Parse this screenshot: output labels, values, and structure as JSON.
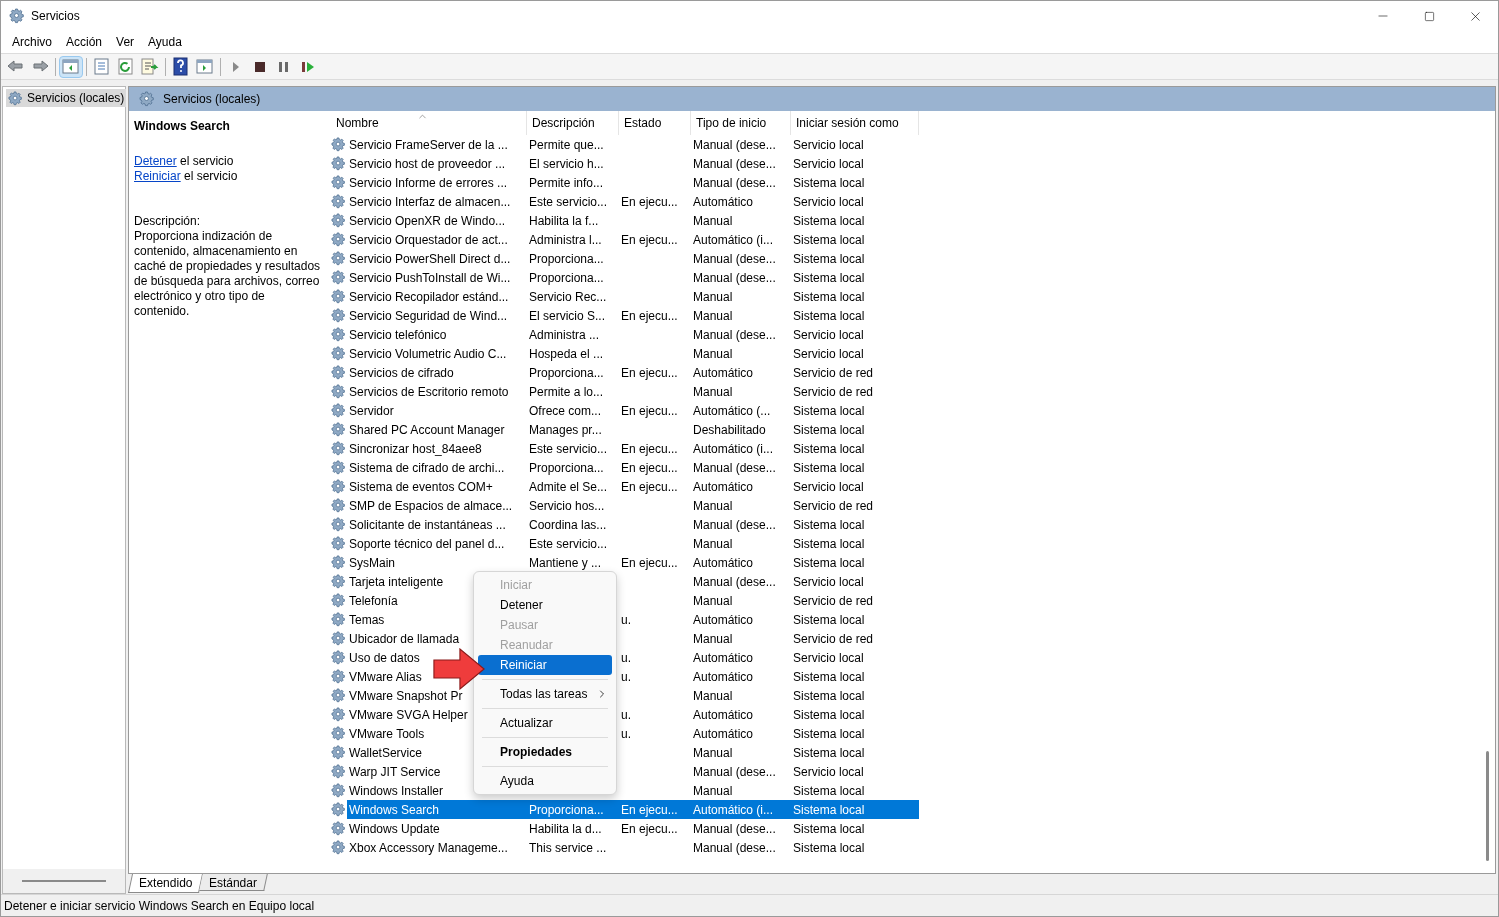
{
  "window": {
    "title": "Servicios"
  },
  "menu": [
    "Archivo",
    "Acción",
    "Ver",
    "Ayuda"
  ],
  "toolbar": [
    {
      "kind": "back",
      "selected": false
    },
    {
      "kind": "forward",
      "selected": false
    },
    {
      "kind": "tree",
      "selected": true
    },
    {
      "kind": "properties",
      "selected": false
    },
    {
      "kind": "refresh",
      "selected": false
    },
    {
      "kind": "export",
      "selected": false
    },
    {
      "kind": "help",
      "selected": false
    },
    {
      "kind": "view",
      "selected": false
    },
    {
      "kind": "play",
      "selected": false
    },
    {
      "kind": "stop",
      "selected": false
    },
    {
      "kind": "pause",
      "selected": false
    },
    {
      "kind": "restart",
      "selected": false
    }
  ],
  "tree": [
    {
      "label": "Servicios (locales)",
      "selected": true
    }
  ],
  "pane_title": "Servicios (locales)",
  "details": {
    "title": "Windows Search",
    "actions": [
      {
        "link": "Detener",
        "rest": " el servicio"
      },
      {
        "link": "Reiniciar",
        "rest": " el servicio"
      }
    ],
    "description_label": "Descripción:",
    "description": "Proporciona indización de contenido, almacenamiento en caché de propiedades y resultados de búsqueda para archivos, correo electrónico y otro tipo de contenido."
  },
  "table": {
    "columns": [
      "Nombre",
      "Descripción",
      "Estado",
      "Tipo de inicio",
      "Iniciar sesión como"
    ],
    "rows": [
      {
        "name": "Servicio FrameServer de la ...",
        "description": "Permite que...",
        "status": "",
        "startup": "Manual (dese...",
        "logon": "Servicio local",
        "selected": false
      },
      {
        "name": "Servicio host de proveedor ...",
        "description": "El servicio h...",
        "status": "",
        "startup": "Manual (dese...",
        "logon": "Servicio local",
        "selected": false
      },
      {
        "name": "Servicio Informe de errores ...",
        "description": "Permite info...",
        "status": "",
        "startup": "Manual (dese...",
        "logon": "Sistema local",
        "selected": false
      },
      {
        "name": "Servicio Interfaz de almacen...",
        "description": "Este servicio...",
        "status": "En ejecu...",
        "startup": "Automático",
        "logon": "Servicio local",
        "selected": false
      },
      {
        "name": "Servicio OpenXR de Windo...",
        "description": "Habilita la f...",
        "status": "",
        "startup": "Manual",
        "logon": "Sistema local",
        "selected": false
      },
      {
        "name": "Servicio Orquestador de act...",
        "description": "Administra l...",
        "status": "En ejecu...",
        "startup": "Automático (i...",
        "logon": "Sistema local",
        "selected": false
      },
      {
        "name": "Servicio PowerShell Direct d...",
        "description": "Proporciona...",
        "status": "",
        "startup": "Manual (dese...",
        "logon": "Sistema local",
        "selected": false
      },
      {
        "name": "Servicio PushToInstall de Wi...",
        "description": "Proporciona...",
        "status": "",
        "startup": "Manual (dese...",
        "logon": "Sistema local",
        "selected": false
      },
      {
        "name": "Servicio Recopilador estánd...",
        "description": "Servicio Rec...",
        "status": "",
        "startup": "Manual",
        "logon": "Sistema local",
        "selected": false
      },
      {
        "name": "Servicio Seguridad de Wind...",
        "description": "El servicio S...",
        "status": "En ejecu...",
        "startup": "Manual",
        "logon": "Sistema local",
        "selected": false
      },
      {
        "name": "Servicio telefónico",
        "description": "Administra ...",
        "status": "",
        "startup": "Manual (dese...",
        "logon": "Servicio local",
        "selected": false
      },
      {
        "name": "Servicio Volumetric Audio C...",
        "description": "Hospeda el ...",
        "status": "",
        "startup": "Manual",
        "logon": "Servicio local",
        "selected": false
      },
      {
        "name": "Servicios de cifrado",
        "description": "Proporciona...",
        "status": "En ejecu...",
        "startup": "Automático",
        "logon": "Servicio de red",
        "selected": false
      },
      {
        "name": "Servicios de Escritorio remoto",
        "description": "Permite a lo...",
        "status": "",
        "startup": "Manual",
        "logon": "Servicio de red",
        "selected": false
      },
      {
        "name": "Servidor",
        "description": "Ofrece com...",
        "status": "En ejecu...",
        "startup": "Automático (...",
        "logon": "Sistema local",
        "selected": false
      },
      {
        "name": "Shared PC Account Manager",
        "description": "Manages pr...",
        "status": "",
        "startup": "Deshabilitado",
        "logon": "Sistema local",
        "selected": false
      },
      {
        "name": "Sincronizar host_84aee8",
        "description": "Este servicio...",
        "status": "En ejecu...",
        "startup": "Automático (i...",
        "logon": "Sistema local",
        "selected": false
      },
      {
        "name": "Sistema de cifrado de archi...",
        "description": "Proporciona...",
        "status": "En ejecu...",
        "startup": "Manual (dese...",
        "logon": "Sistema local",
        "selected": false
      },
      {
        "name": "Sistema de eventos COM+",
        "description": "Admite el Se...",
        "status": "En ejecu...",
        "startup": "Automático",
        "logon": "Servicio local",
        "selected": false
      },
      {
        "name": "SMP de Espacios de almace...",
        "description": "Servicio hos...",
        "status": "",
        "startup": "Manual",
        "logon": "Servicio de red",
        "selected": false
      },
      {
        "name": "Solicitante de instantáneas ...",
        "description": "Coordina las...",
        "status": "",
        "startup": "Manual (dese...",
        "logon": "Sistema local",
        "selected": false
      },
      {
        "name": "Soporte técnico del panel d...",
        "description": "Este servicio...",
        "status": "",
        "startup": "Manual",
        "logon": "Sistema local",
        "selected": false
      },
      {
        "name": "SysMain",
        "description": "Mantiene y ...",
        "status": "En ejecu...",
        "startup": "Automático",
        "logon": "Sistema local",
        "selected": false
      },
      {
        "name": "Tarjeta inteligente",
        "description": "",
        "status": "",
        "startup": "Manual (dese...",
        "logon": "Servicio local",
        "selected": false
      },
      {
        "name": "Telefonía",
        "description": "",
        "status": "",
        "startup": "Manual",
        "logon": "Servicio de red",
        "selected": false
      },
      {
        "name": "Temas",
        "description": "",
        "status": "u.",
        "startup": "Automático",
        "logon": "Sistema local",
        "selected": false
      },
      {
        "name": "Ubicador de llamada",
        "description": "",
        "status": "",
        "startup": "Manual",
        "logon": "Servicio de red",
        "selected": false
      },
      {
        "name": "Uso de datos",
        "description": "",
        "status": "u.",
        "startup": "Automático",
        "logon": "Servicio local",
        "selected": false
      },
      {
        "name": "VMware Alias",
        "description": "",
        "status": "u.",
        "startup": "Automático",
        "logon": "Sistema local",
        "selected": false
      },
      {
        "name": "VMware Snapshot Pr",
        "description": "",
        "status": "",
        "startup": "Manual",
        "logon": "Sistema local",
        "selected": false
      },
      {
        "name": "VMware SVGA Helper",
        "description": "",
        "status": "u.",
        "startup": "Automático",
        "logon": "Sistema local",
        "selected": false
      },
      {
        "name": "VMware Tools",
        "description": "",
        "status": "u.",
        "startup": "Automático",
        "logon": "Sistema local",
        "selected": false
      },
      {
        "name": "WalletService",
        "description": "",
        "status": "",
        "startup": "Manual",
        "logon": "Sistema local",
        "selected": false
      },
      {
        "name": "Warp JIT Service",
        "description": "",
        "status": "",
        "startup": "Manual (dese...",
        "logon": "Servicio local",
        "selected": false
      },
      {
        "name": "Windows Installer",
        "description": "",
        "status": "",
        "startup": "Manual",
        "logon": "Sistema local",
        "selected": false
      },
      {
        "name": "Windows Search",
        "description": "Proporciona...",
        "status": "En ejecu...",
        "startup": "Automático (i...",
        "logon": "Sistema local",
        "selected": true
      },
      {
        "name": "Windows Update",
        "description": "Habilita la d...",
        "status": "En ejecu...",
        "startup": "Manual (dese...",
        "logon": "Sistema local",
        "selected": false
      },
      {
        "name": "Xbox Accessory Manageme...",
        "description": "This service ...",
        "status": "",
        "startup": "Manual (dese...",
        "logon": "Sistema local",
        "selected": false
      }
    ]
  },
  "context_menu": [
    {
      "kind": "item",
      "label": "Iniciar",
      "disabled": true,
      "selected": false
    },
    {
      "kind": "item",
      "label": "Detener",
      "disabled": false,
      "selected": false
    },
    {
      "kind": "item",
      "label": "Pausar",
      "disabled": true,
      "selected": false
    },
    {
      "kind": "item",
      "label": "Reanudar",
      "disabled": true,
      "selected": false
    },
    {
      "kind": "item",
      "label": "Reiniciar",
      "disabled": false,
      "selected": true
    },
    {
      "kind": "separator"
    },
    {
      "kind": "submenu",
      "label": "Todas las tareas",
      "disabled": false,
      "selected": false
    },
    {
      "kind": "separator"
    },
    {
      "kind": "item",
      "label": "Actualizar",
      "disabled": false,
      "selected": false
    },
    {
      "kind": "separator"
    },
    {
      "kind": "default",
      "label": "Propiedades",
      "disabled": false,
      "selected": false
    },
    {
      "kind": "separator"
    },
    {
      "kind": "item",
      "label": "Ayuda",
      "disabled": false,
      "selected": false
    }
  ],
  "bottom_tabs": [
    {
      "label": "Extendido",
      "selected": true
    },
    {
      "label": "Estándar",
      "selected": false
    }
  ],
  "status_bar": "Detener e iniciar servicio Windows Search en Equipo local"
}
